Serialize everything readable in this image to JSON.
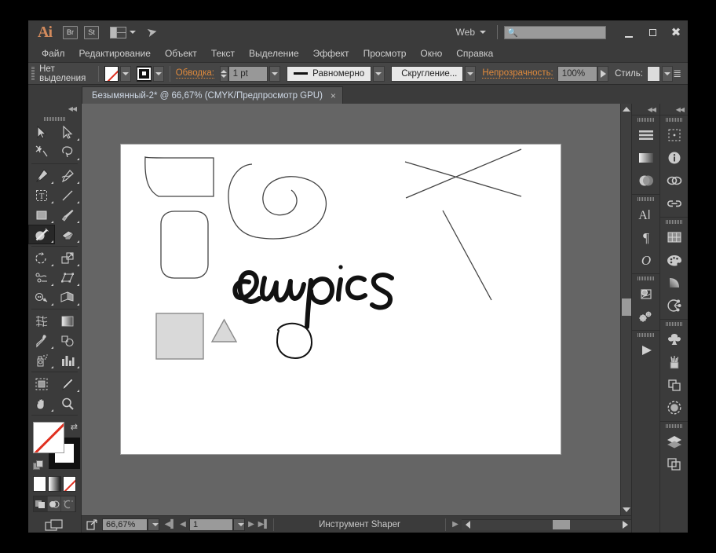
{
  "app": {
    "logo": "Ai",
    "bridge_button": "Br",
    "stock_button": "St",
    "arrange_tooltip": "arrange-documents",
    "workspace_label": "Web",
    "search_placeholder": "",
    "search_value": ""
  },
  "menu": {
    "items": [
      "Файл",
      "Редактирование",
      "Объект",
      "Текст",
      "Выделение",
      "Эффект",
      "Просмотр",
      "Окно",
      "Справка"
    ]
  },
  "control_bar": {
    "selection_label": "Нет выделения",
    "stroke_label": "Обводка:",
    "stroke_weight": "1 pt",
    "stroke_profile": "Равномерно",
    "corner_label": "Скругление...",
    "opacity_label": "Непрозрачность:",
    "opacity_value": "100%",
    "style_label": "Стиль:"
  },
  "document": {
    "tab_title": "Безымянный-2* @ 66,67% (CMYK/Предпросмотр GPU)",
    "close_glyph": "×"
  },
  "status_bar": {
    "zoom_value": "66,67%",
    "page_value": "1",
    "tool_name": "Инструмент Shaper"
  },
  "toolbar": {
    "collapse_glyph": "◀◀",
    "tools": [
      {
        "name": "selection-tool",
        "label": "Выделение"
      },
      {
        "name": "direct-selection-tool",
        "label": "Прямое выделение"
      },
      {
        "name": "magic-wand-tool",
        "label": "Волшебная палочка"
      },
      {
        "name": "lasso-tool",
        "label": "Лассо"
      },
      {
        "name": "pen-tool",
        "label": "Перо"
      },
      {
        "name": "curvature-tool",
        "label": "Кривизна"
      },
      {
        "name": "type-tool",
        "label": "Текст"
      },
      {
        "name": "line-segment-tool",
        "label": "Отрезок линии"
      },
      {
        "name": "rectangle-tool",
        "label": "Прямоугольник"
      },
      {
        "name": "paintbrush-tool",
        "label": "Кисть"
      },
      {
        "name": "shaper-tool",
        "label": "Shaper",
        "selected": true
      },
      {
        "name": "eraser-tool",
        "label": "Ластик"
      },
      {
        "name": "rotate-tool",
        "label": "Поворот"
      },
      {
        "name": "scale-tool",
        "label": "Масштаб"
      },
      {
        "name": "width-tool",
        "label": "Ширина"
      },
      {
        "name": "free-transform-tool",
        "label": "Свободное трансформирование"
      },
      {
        "name": "shape-builder-tool",
        "label": "Создание фигур"
      },
      {
        "name": "perspective-grid-tool",
        "label": "Сетка перспективы"
      },
      {
        "name": "mesh-tool",
        "label": "Сетка"
      },
      {
        "name": "gradient-tool",
        "label": "Градиент"
      },
      {
        "name": "eyedropper-tool",
        "label": "Пипетка"
      },
      {
        "name": "blend-tool",
        "label": "Переход"
      },
      {
        "name": "symbol-sprayer-tool",
        "label": "Распыление символов"
      },
      {
        "name": "column-graph-tool",
        "label": "Диаграмма"
      },
      {
        "name": "artboard-tool",
        "label": "Монтажная область"
      },
      {
        "name": "slice-tool",
        "label": "Фрагмент"
      },
      {
        "name": "hand-tool",
        "label": "Рука"
      },
      {
        "name": "zoom-tool",
        "label": "Масштаб"
      }
    ],
    "fill_state": "none",
    "stroke_state": "black",
    "modes": [
      {
        "name": "color-mode",
        "label": "Цвет"
      },
      {
        "name": "gradient-mode",
        "label": "Градиент"
      },
      {
        "name": "none-mode",
        "label": "Нет"
      }
    ],
    "draw_modes": [
      {
        "name": "draw-normal-mode",
        "active": true
      },
      {
        "name": "draw-behind-mode",
        "active": false
      },
      {
        "name": "draw-inside-mode",
        "active": false
      }
    ]
  },
  "right_panels": {
    "collapse_glyph": "◀◀",
    "inner_column": [
      {
        "group": 1,
        "items": [
          "color-panel-icon",
          "gradient-panel-icon",
          "transparency-panel-icon"
        ]
      },
      {
        "group": 2,
        "items": [
          "character-panel-icon",
          "paragraph-panel-icon",
          "glyphs-panel-icon"
        ]
      },
      {
        "group": 3,
        "items": [
          "image-trace-panel-icon",
          "actions-panel-icon"
        ]
      },
      {
        "group": 4,
        "items": [
          "play-panel-icon"
        ]
      }
    ],
    "outer_column": [
      {
        "group": 1,
        "items": [
          "properties-panel-icon",
          "info-panel-icon",
          "libraries-panel-icon",
          "links-panel-icon"
        ]
      },
      {
        "group": 2,
        "items": [
          "swatches-panel-icon",
          "color-guide-panel-icon",
          "gradient-fill-icon",
          "color-themes-panel-icon"
        ]
      },
      {
        "group": 3,
        "items": [
          "symbols-panel-icon",
          "brushes-panel-icon",
          "pathfinder-panel-icon",
          "appearance-panel-icon"
        ]
      },
      {
        "group": 4,
        "items": [
          "layers-panel-icon",
          "artboards-panel-icon"
        ]
      }
    ]
  },
  "artwork": {
    "handwritten_text": "eumpics",
    "shapes": [
      {
        "name": "curved-banner-shape",
        "type": "path"
      },
      {
        "name": "rounded-rectangle-shape",
        "type": "path"
      },
      {
        "name": "spiral-shape",
        "type": "path"
      },
      {
        "name": "filled-square-shape",
        "type": "rect",
        "fill": "#d9d9d9"
      },
      {
        "name": "filled-triangle-shape",
        "type": "polygon",
        "fill": "#d9d9d9"
      },
      {
        "name": "hand-drawn-circle-shape",
        "type": "path"
      },
      {
        "name": "crossed-lines-shape",
        "type": "path"
      },
      {
        "name": "diagonal-line-shape",
        "type": "path"
      }
    ]
  },
  "colors": {
    "chrome": "#3b3b3b",
    "control_bar": "#464646",
    "canvas": "#656565",
    "accent_orange": "#e08a3c",
    "tab_text": "#cfd9e6",
    "artboard": "#ffffff",
    "stroke": "#333333"
  }
}
